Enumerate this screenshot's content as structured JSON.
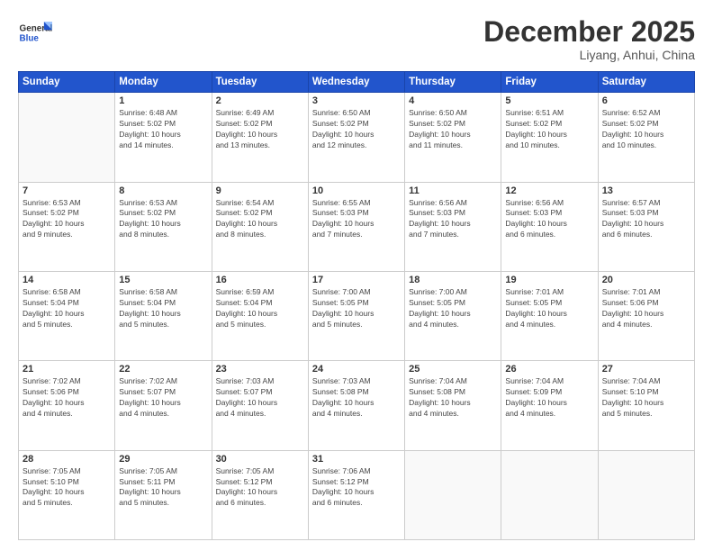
{
  "header": {
    "logo_general": "General",
    "logo_blue": "Blue",
    "month": "December 2025",
    "location": "Liyang, Anhui, China"
  },
  "days_of_week": [
    "Sunday",
    "Monday",
    "Tuesday",
    "Wednesday",
    "Thursday",
    "Friday",
    "Saturday"
  ],
  "weeks": [
    [
      {
        "day": "",
        "info": ""
      },
      {
        "day": "1",
        "info": "Sunrise: 6:48 AM\nSunset: 5:02 PM\nDaylight: 10 hours\nand 14 minutes."
      },
      {
        "day": "2",
        "info": "Sunrise: 6:49 AM\nSunset: 5:02 PM\nDaylight: 10 hours\nand 13 minutes."
      },
      {
        "day": "3",
        "info": "Sunrise: 6:50 AM\nSunset: 5:02 PM\nDaylight: 10 hours\nand 12 minutes."
      },
      {
        "day": "4",
        "info": "Sunrise: 6:50 AM\nSunset: 5:02 PM\nDaylight: 10 hours\nand 11 minutes."
      },
      {
        "day": "5",
        "info": "Sunrise: 6:51 AM\nSunset: 5:02 PM\nDaylight: 10 hours\nand 10 minutes."
      },
      {
        "day": "6",
        "info": "Sunrise: 6:52 AM\nSunset: 5:02 PM\nDaylight: 10 hours\nand 10 minutes."
      }
    ],
    [
      {
        "day": "7",
        "info": "Sunrise: 6:53 AM\nSunset: 5:02 PM\nDaylight: 10 hours\nand 9 minutes."
      },
      {
        "day": "8",
        "info": "Sunrise: 6:53 AM\nSunset: 5:02 PM\nDaylight: 10 hours\nand 8 minutes."
      },
      {
        "day": "9",
        "info": "Sunrise: 6:54 AM\nSunset: 5:02 PM\nDaylight: 10 hours\nand 8 minutes."
      },
      {
        "day": "10",
        "info": "Sunrise: 6:55 AM\nSunset: 5:03 PM\nDaylight: 10 hours\nand 7 minutes."
      },
      {
        "day": "11",
        "info": "Sunrise: 6:56 AM\nSunset: 5:03 PM\nDaylight: 10 hours\nand 7 minutes."
      },
      {
        "day": "12",
        "info": "Sunrise: 6:56 AM\nSunset: 5:03 PM\nDaylight: 10 hours\nand 6 minutes."
      },
      {
        "day": "13",
        "info": "Sunrise: 6:57 AM\nSunset: 5:03 PM\nDaylight: 10 hours\nand 6 minutes."
      }
    ],
    [
      {
        "day": "14",
        "info": "Sunrise: 6:58 AM\nSunset: 5:04 PM\nDaylight: 10 hours\nand 5 minutes."
      },
      {
        "day": "15",
        "info": "Sunrise: 6:58 AM\nSunset: 5:04 PM\nDaylight: 10 hours\nand 5 minutes."
      },
      {
        "day": "16",
        "info": "Sunrise: 6:59 AM\nSunset: 5:04 PM\nDaylight: 10 hours\nand 5 minutes."
      },
      {
        "day": "17",
        "info": "Sunrise: 7:00 AM\nSunset: 5:05 PM\nDaylight: 10 hours\nand 5 minutes."
      },
      {
        "day": "18",
        "info": "Sunrise: 7:00 AM\nSunset: 5:05 PM\nDaylight: 10 hours\nand 4 minutes."
      },
      {
        "day": "19",
        "info": "Sunrise: 7:01 AM\nSunset: 5:05 PM\nDaylight: 10 hours\nand 4 minutes."
      },
      {
        "day": "20",
        "info": "Sunrise: 7:01 AM\nSunset: 5:06 PM\nDaylight: 10 hours\nand 4 minutes."
      }
    ],
    [
      {
        "day": "21",
        "info": "Sunrise: 7:02 AM\nSunset: 5:06 PM\nDaylight: 10 hours\nand 4 minutes."
      },
      {
        "day": "22",
        "info": "Sunrise: 7:02 AM\nSunset: 5:07 PM\nDaylight: 10 hours\nand 4 minutes."
      },
      {
        "day": "23",
        "info": "Sunrise: 7:03 AM\nSunset: 5:07 PM\nDaylight: 10 hours\nand 4 minutes."
      },
      {
        "day": "24",
        "info": "Sunrise: 7:03 AM\nSunset: 5:08 PM\nDaylight: 10 hours\nand 4 minutes."
      },
      {
        "day": "25",
        "info": "Sunrise: 7:04 AM\nSunset: 5:08 PM\nDaylight: 10 hours\nand 4 minutes."
      },
      {
        "day": "26",
        "info": "Sunrise: 7:04 AM\nSunset: 5:09 PM\nDaylight: 10 hours\nand 4 minutes."
      },
      {
        "day": "27",
        "info": "Sunrise: 7:04 AM\nSunset: 5:10 PM\nDaylight: 10 hours\nand 5 minutes."
      }
    ],
    [
      {
        "day": "28",
        "info": "Sunrise: 7:05 AM\nSunset: 5:10 PM\nDaylight: 10 hours\nand 5 minutes."
      },
      {
        "day": "29",
        "info": "Sunrise: 7:05 AM\nSunset: 5:11 PM\nDaylight: 10 hours\nand 5 minutes."
      },
      {
        "day": "30",
        "info": "Sunrise: 7:05 AM\nSunset: 5:12 PM\nDaylight: 10 hours\nand 6 minutes."
      },
      {
        "day": "31",
        "info": "Sunrise: 7:06 AM\nSunset: 5:12 PM\nDaylight: 10 hours\nand 6 minutes."
      },
      {
        "day": "",
        "info": ""
      },
      {
        "day": "",
        "info": ""
      },
      {
        "day": "",
        "info": ""
      }
    ]
  ]
}
